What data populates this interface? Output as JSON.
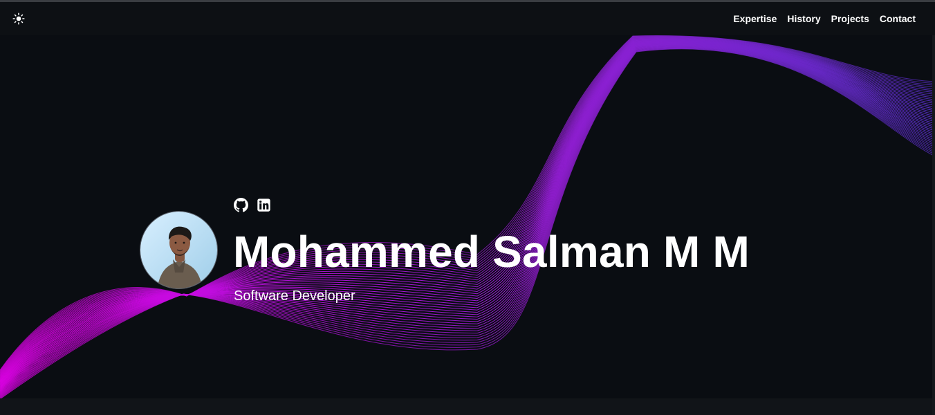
{
  "navbar": {
    "theme_toggle_icon": "sun-icon",
    "links": [
      {
        "label": "Expertise"
      },
      {
        "label": "History"
      },
      {
        "label": "Projects"
      },
      {
        "label": "Contact"
      }
    ]
  },
  "hero": {
    "name": "Mohammed Salman M M",
    "role": "Software Developer",
    "avatar_icon": "profile-photo",
    "social_icons": [
      "github-icon",
      "linkedin-icon"
    ]
  },
  "colors": {
    "background": "#0a0d12",
    "navbar": "#0d1014",
    "text": "#ffffff",
    "wave_start": "#e800f0",
    "wave_mid": "#9b18e0",
    "wave_end": "#5b2fd0"
  }
}
